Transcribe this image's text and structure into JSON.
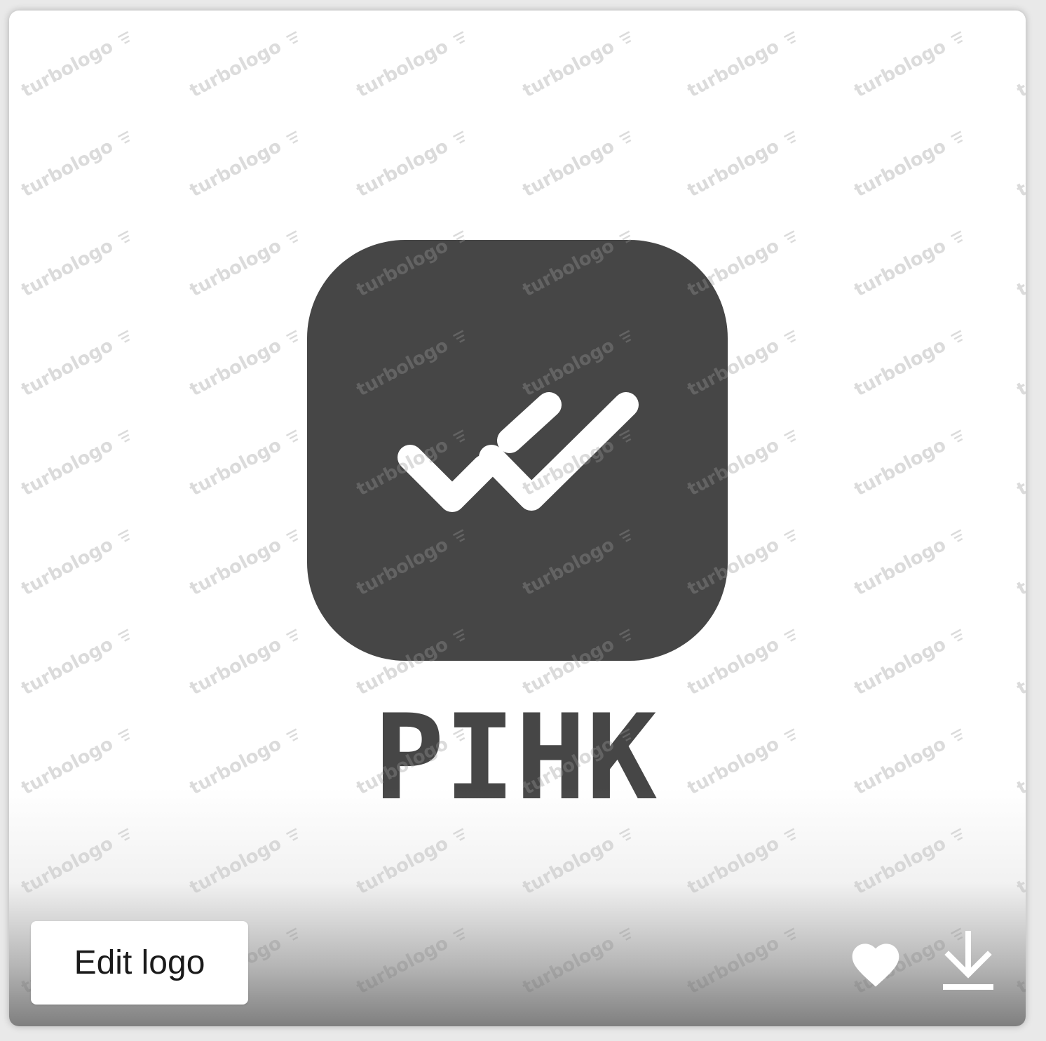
{
  "card": {
    "brand_name": "PIHK",
    "watermark_text": "turbologo",
    "edit_button_label": "Edit logo"
  },
  "icons": {
    "logo_mark": "double-check-icon",
    "favorite": "heart-icon",
    "download": "download-icon"
  },
  "colors": {
    "logo_fill": "#464646",
    "brand_text": "#464646",
    "watermark": "#9a9a9a",
    "card_background": "#ffffff"
  }
}
